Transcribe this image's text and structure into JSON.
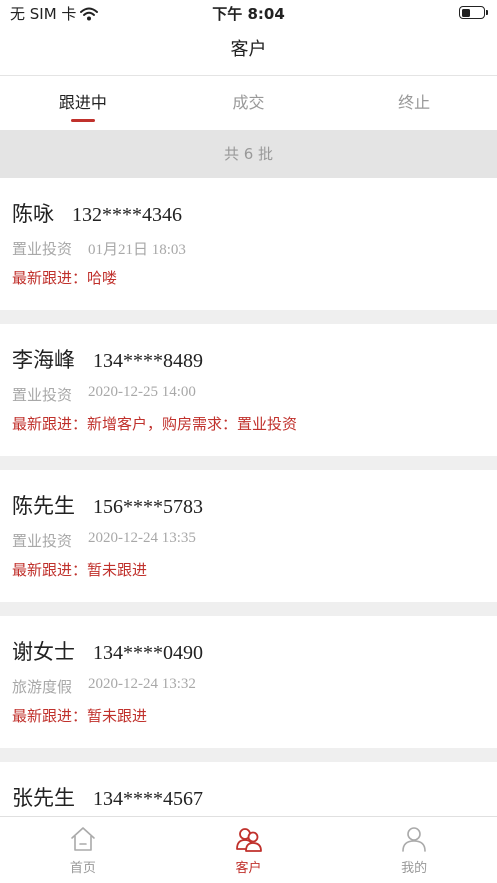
{
  "status_bar": {
    "carrier": "无 SIM 卡",
    "time": "下午 8:04",
    "icons": [
      "wifi-icon",
      "battery-icon"
    ]
  },
  "header": {
    "title": "客户"
  },
  "tabs": [
    {
      "label": "跟进中",
      "active": true
    },
    {
      "label": "成交",
      "active": false
    },
    {
      "label": "终止",
      "active": false
    }
  ],
  "count_text": "共 6 批",
  "customers": [
    {
      "name": "陈咏",
      "phone": "132****4346",
      "category": "置业投资",
      "time": "01月21日 18:03",
      "follow": "最新跟进：哈喽"
    },
    {
      "name": "李海峰",
      "phone": "134****8489",
      "category": "置业投资",
      "time": "2020-12-25 14:00",
      "follow": "最新跟进：新增客户，购房需求：置业投资"
    },
    {
      "name": "陈先生",
      "phone": "156****5783",
      "category": "置业投资",
      "time": "2020-12-24 13:35",
      "follow": "最新跟进：暂未跟进"
    },
    {
      "name": "谢女士",
      "phone": "134****0490",
      "category": "旅游度假",
      "time": "2020-12-24 13:32",
      "follow": "最新跟进：暂未跟进"
    },
    {
      "name": "张先生",
      "phone": "134****4567",
      "category": "",
      "time": "",
      "follow": ""
    }
  ],
  "tabbar": [
    {
      "label": "首页",
      "icon": "home-icon",
      "active": false
    },
    {
      "label": "客户",
      "icon": "customers-icon",
      "active": true
    },
    {
      "label": "我的",
      "icon": "profile-icon",
      "active": false
    }
  ],
  "colors": {
    "accent": "#c0312c",
    "muted": "#999999",
    "page_bg": "#efefef"
  }
}
